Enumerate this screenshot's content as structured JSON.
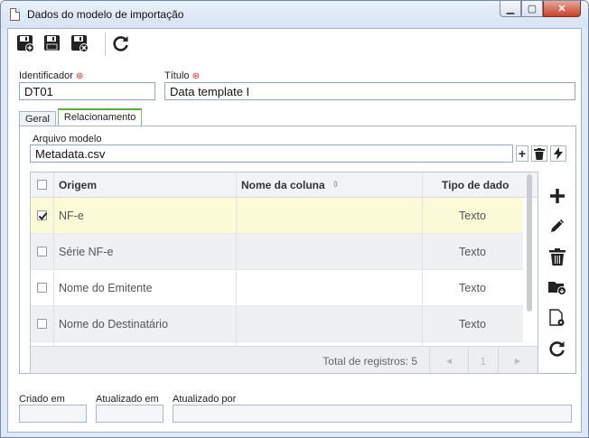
{
  "window": {
    "title": "Dados do modelo de importação"
  },
  "form": {
    "identificador_label": "Identificador",
    "identificador_value": "DT01",
    "titulo_label": "Título",
    "titulo_value": "Data template I"
  },
  "tabs": [
    {
      "label": "Geral"
    },
    {
      "label": "Relacionamento"
    }
  ],
  "relacionamento": {
    "arquivo_label": "Arquivo modelo",
    "arquivo_value": "Metadata.csv"
  },
  "grid": {
    "columns": [
      "Origem",
      "Nome da coluna",
      "Tipo de dado"
    ],
    "rows": [
      {
        "origem": "NF-e",
        "nome_coluna": "",
        "tipo": "Texto",
        "checked": true
      },
      {
        "origem": "Série NF-e",
        "nome_coluna": "",
        "tipo": "Texto",
        "checked": false
      },
      {
        "origem": "Nome do Emitente",
        "nome_coluna": "",
        "tipo": "Texto",
        "checked": false
      },
      {
        "origem": "Nome do Destinatário",
        "nome_coluna": "",
        "tipo": "Texto",
        "checked": false
      }
    ],
    "total_text": "Total de registros: 5",
    "page": "1"
  },
  "footer": {
    "criado_label": "Criado em",
    "atualizado_label": "Atualizado em",
    "atualizado_por_label": "Atualizado por"
  },
  "colors": {
    "selected_row": "#fbfbd8",
    "alt_row": "#eef0f2",
    "required": "#dd2222"
  }
}
